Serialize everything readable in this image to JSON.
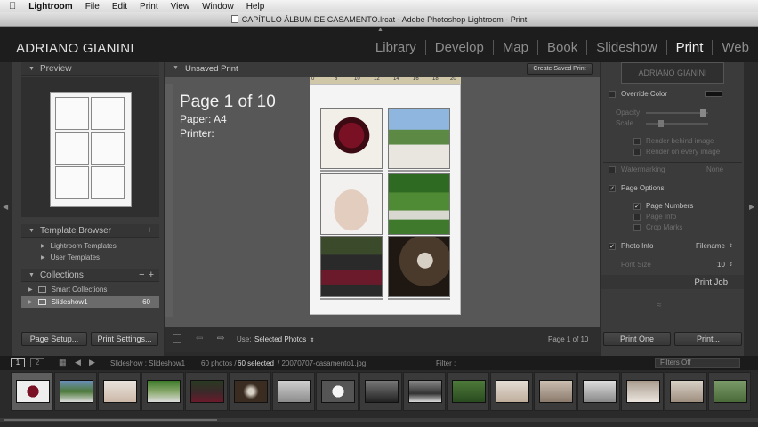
{
  "menubar": {
    "app": "Lightroom",
    "items": [
      "File",
      "Edit",
      "Print",
      "View",
      "Window",
      "Help"
    ]
  },
  "window": {
    "title": "CAPÍTULO ÁLBUM DE CASAMENTO.lrcat - Adobe Photoshop Lightroom - Print"
  },
  "identity": "ADRIANO GIANINI",
  "modules": [
    "Library",
    "Develop",
    "Map",
    "Book",
    "Slideshow",
    "Print",
    "Web"
  ],
  "left_panel": {
    "preview_label": "Preview",
    "template_browser_label": "Template Browser",
    "templates": [
      "Lightroom Templates",
      "User Templates"
    ],
    "collections_label": "Collections",
    "collections": [
      {
        "name": "Smart Collections",
        "count": ""
      },
      {
        "name": "Slideshow1",
        "count": "60"
      }
    ],
    "page_setup_label": "Page Setup...",
    "print_settings_label": "Print Settings..."
  },
  "center": {
    "title": "Unsaved Print",
    "create_saved_label": "Create Saved Print",
    "ruler_ticks": [
      "0",
      "8",
      "10",
      "12",
      "14",
      "16",
      "18",
      "20"
    ],
    "page_line": "Page 1 of 10",
    "paper_line": "Paper:  A4",
    "printer_line": "Printer:",
    "use_label": "Use:",
    "use_value": "Selected Photos",
    "page_count": "Page 1 of 10"
  },
  "right_panel": {
    "identity_plate_text": "ADRIANO GIANINI",
    "override_color": "Override Color",
    "opacity": "Opacity",
    "scale": "Scale",
    "render_behind": "Render behind image",
    "render_every": "Render on every image",
    "watermarking": "Watermarking",
    "watermarking_value": "None",
    "page_options": "Page Options",
    "page_numbers": "Page Numbers",
    "page_info": "Page Info",
    "crop_marks": "Crop Marks",
    "photo_info": "Photo Info",
    "photo_info_value": "Filename",
    "font_size": "Font Size",
    "font_size_value": "10",
    "print_job": "Print Job",
    "print_one": "Print One",
    "print": "Print..."
  },
  "filmstrip": {
    "page_1": "1",
    "page_2": "2",
    "source": "Slideshow : Slideshow1",
    "count": "60 photos /",
    "selected": "60 selected",
    "filename": "/ 20070707-casamento1.jpg",
    "filter_label": "Filter :",
    "filter_value": "Filters Off"
  },
  "colors": {
    "panel": "#3b3b3b",
    "background": "#575757",
    "accent_rose": "#7a1024",
    "accent_green": "#3f7a2c"
  }
}
